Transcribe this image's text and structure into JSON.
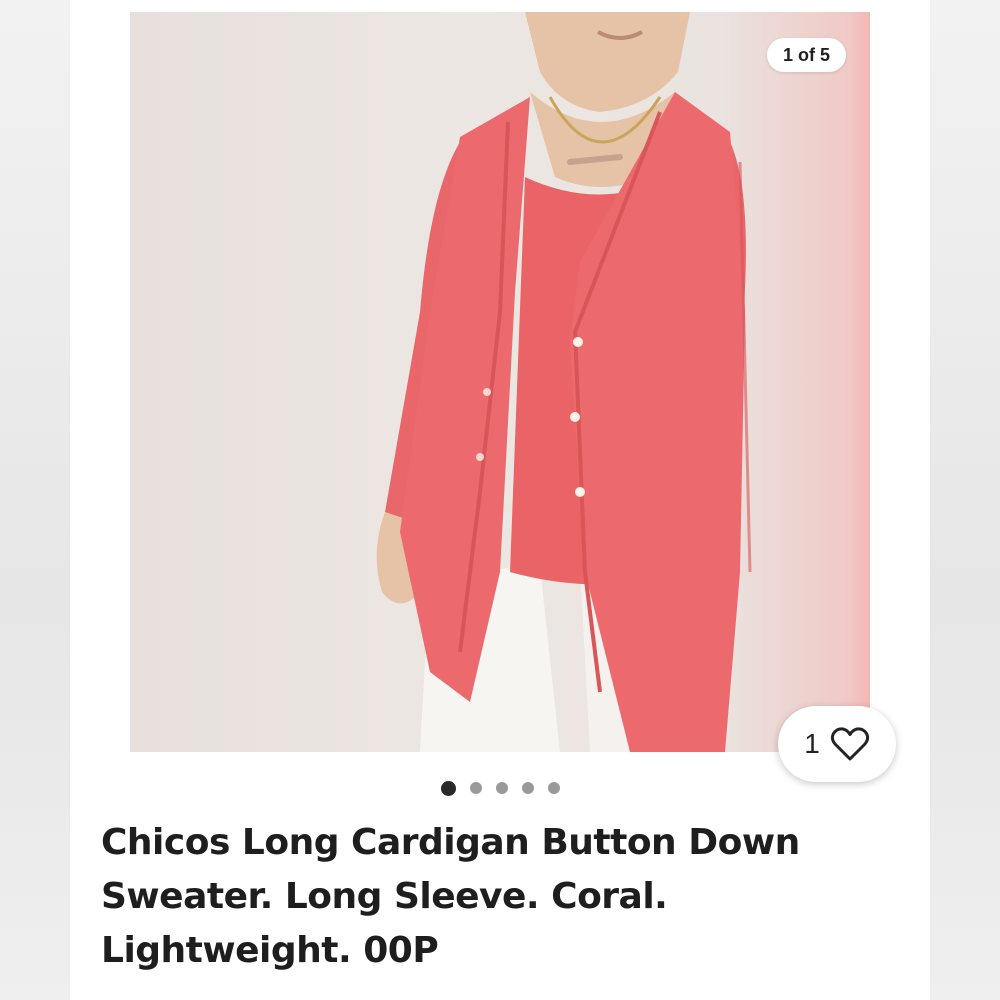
{
  "gallery": {
    "counter": "1 of 5",
    "image_alt": "Model wearing a long coral button-down cardigan over a coral top with white pants",
    "dot_count": 5,
    "active_index": 0
  },
  "like": {
    "count": "1"
  },
  "listing": {
    "title": "Chicos Long Cardigan Button Down Sweater. Long Sleeve. Coral. Lightweight. 00P"
  },
  "colors": {
    "garment": "#ec6a6d",
    "garment_shadow": "#d85558",
    "pants": "#f7f5f2",
    "skin": "#e6c2a6"
  },
  "icons": [
    "heart-outline-icon"
  ]
}
